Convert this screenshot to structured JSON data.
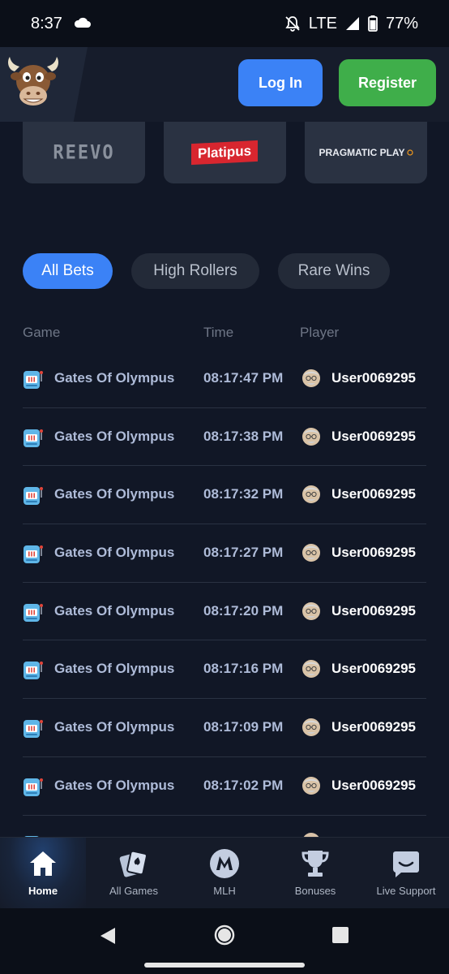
{
  "status_bar": {
    "time": "8:37",
    "network": "LTE",
    "battery": "77%"
  },
  "header": {
    "logo_icon": "bull-mascot-icon",
    "login_label": "Log In",
    "register_label": "Register",
    "login_color": "#3b82f6",
    "register_color": "#3fae4a"
  },
  "providers": [
    {
      "name": "REEVO"
    },
    {
      "name": "Platipus"
    },
    {
      "name": "PRAGMATIC PLAY"
    }
  ],
  "tabs": [
    {
      "label": "All Bets",
      "active": true
    },
    {
      "label": "High Rollers",
      "active": false
    },
    {
      "label": "Rare Wins",
      "active": false
    }
  ],
  "table": {
    "headers": {
      "game": "Game",
      "time": "Time",
      "player": "Player"
    },
    "rows": [
      {
        "game": "Gates Of Olympus",
        "time": "08:17:47 PM",
        "player": "User0069295"
      },
      {
        "game": "Gates Of Olympus",
        "time": "08:17:38 PM",
        "player": "User0069295"
      },
      {
        "game": "Gates Of Olympus",
        "time": "08:17:32 PM",
        "player": "User0069295"
      },
      {
        "game": "Gates Of Olympus",
        "time": "08:17:27 PM",
        "player": "User0069295"
      },
      {
        "game": "Gates Of Olympus",
        "time": "08:17:20 PM",
        "player": "User0069295"
      },
      {
        "game": "Gates Of Olympus",
        "time": "08:17:16 PM",
        "player": "User0069295"
      },
      {
        "game": "Gates Of Olympus",
        "time": "08:17:09 PM",
        "player": "User0069295"
      },
      {
        "game": "Gates Of Olympus",
        "time": "08:17:02 PM",
        "player": "User0069295"
      }
    ]
  },
  "bottom_nav": [
    {
      "label": "Home",
      "icon": "home-icon",
      "active": true
    },
    {
      "label": "All Games",
      "icon": "cards-icon",
      "active": false
    },
    {
      "label": "MLH",
      "icon": "mlh-logo-icon",
      "active": false
    },
    {
      "label": "Bonuses",
      "icon": "trophy-icon",
      "active": false
    },
    {
      "label": "Live Support",
      "icon": "chat-icon",
      "active": false
    }
  ]
}
